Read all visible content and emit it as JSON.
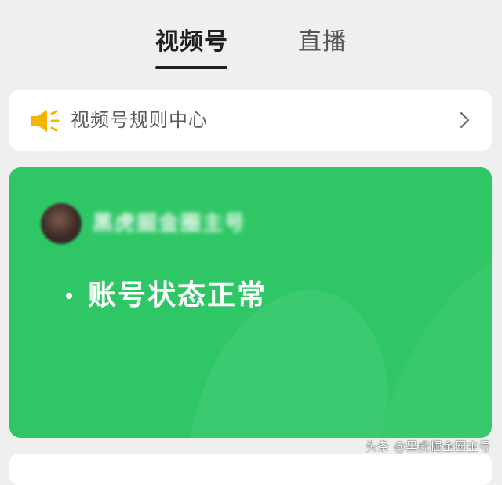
{
  "tabs": {
    "active_label": "视频号",
    "inactive_label": "直播"
  },
  "rules": {
    "label": "视频号规则中心",
    "icon": "speaker-icon",
    "chevron_icon": "chevron-right-icon",
    "icon_color": "#f5b400"
  },
  "status_card": {
    "account_name": "黑虎掘金圈主号",
    "status_text": "账号状态正常",
    "background_color": "#2fc766"
  },
  "watermark": {
    "text": "头条 @黑虎掘金圈主号"
  }
}
